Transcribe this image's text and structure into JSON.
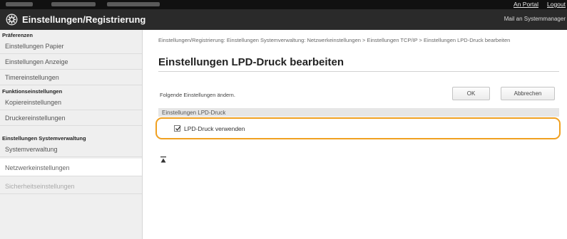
{
  "topbar": {
    "portal_link": "An Portal",
    "logout_link": "Logout"
  },
  "header": {
    "title": "Einstellungen/Registrierung",
    "user_info": "Mail an Systemmanager"
  },
  "sidebar": {
    "sections": [
      {
        "heading": "Präferenzen",
        "items": [
          "Einstellungen Papier",
          "Einstellungen Anzeige",
          "Timereinstellungen"
        ]
      },
      {
        "heading": "Funktionseinstellungen",
        "items": [
          "Kopiereinstellungen",
          "Druckereinstellungen"
        ]
      },
      {
        "heading": "Einstellungen Systemverwaltung",
        "items": [
          "Systemverwaltung",
          "Netzwerkeinstellungen",
          "Sicherheitseinstellungen"
        ]
      }
    ],
    "active_item": "Netzwerkeinstellungen"
  },
  "main": {
    "breadcrumb": "Einstellungen/Registrierung: Einstellungen Systemverwaltung: Netzwerkeinstellungen > Einstellungen TCP/IP > Einstellungen LPD-Druck bearbeiten",
    "page_title": "Einstellungen LPD-Druck bearbeiten",
    "instruction": "Folgende Einstellungen ändern.",
    "ok_button": "OK",
    "cancel_button": "Abbrechen",
    "section_header": "Einstellungen LPD-Druck",
    "checkbox_label": "LPD-Druck verwenden",
    "checkbox_checked": true
  },
  "colors": {
    "highlight": "#f0a020",
    "header_bg": "#2a2a2a",
    "topbar_bg": "#111111"
  },
  "icons": {
    "header": "gear-icon",
    "back_to_top": "arrow-up-icon"
  }
}
